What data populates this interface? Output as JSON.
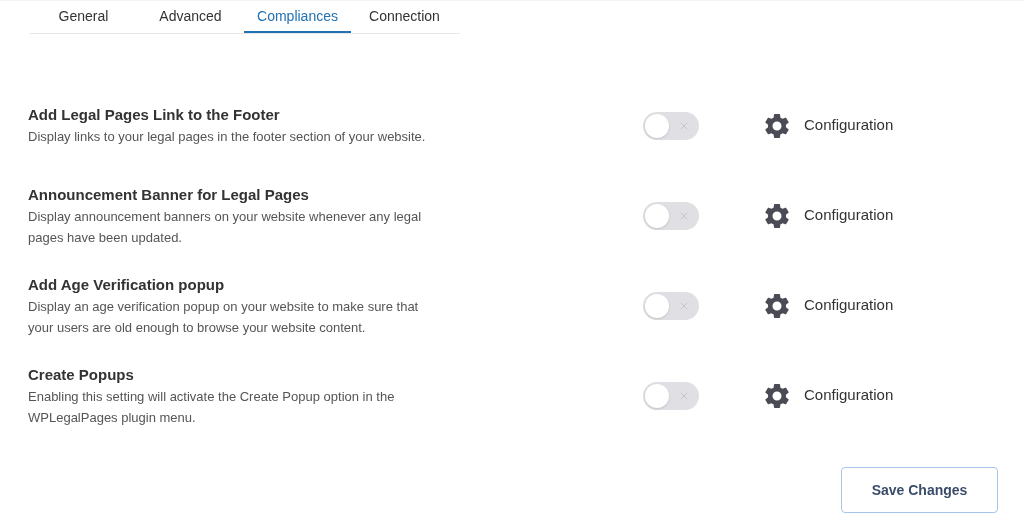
{
  "tabs": [
    {
      "label": "General",
      "selected": false
    },
    {
      "label": "Advanced",
      "selected": false
    },
    {
      "label": "Compliances",
      "selected": true
    },
    {
      "label": "Connection",
      "selected": false
    }
  ],
  "settings": [
    {
      "title": "Add Legal Pages Link to the Footer",
      "description": "Display links to your legal pages in the footer section of your website.",
      "on": false,
      "action": "Configuration"
    },
    {
      "title": "Announcement Banner for Legal Pages",
      "description": "Display announcement banners on your website whenever any legal pages have been updated.",
      "on": false,
      "action": "Configuration"
    },
    {
      "title": "Add Age Verification popup",
      "description": "Display an age verification popup on your website to make sure that your users are old enough to browse your website content.",
      "on": false,
      "action": "Configuration"
    },
    {
      "title": "Create Popups",
      "description": "Enabling this setting will activate the Create Popup option in the WPLegalPages plugin menu.",
      "on": false,
      "action": "Configuration"
    }
  ],
  "save_button": "Save Changes"
}
